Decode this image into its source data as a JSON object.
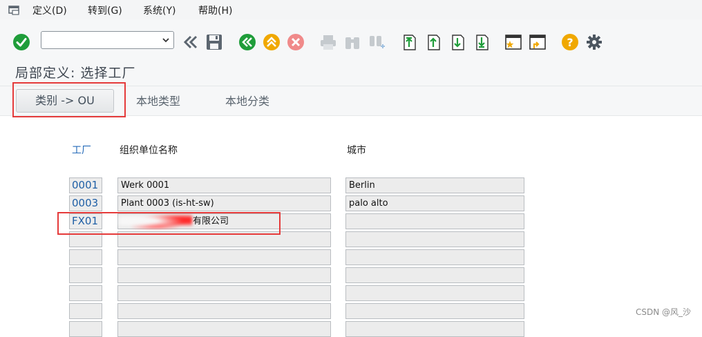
{
  "menu": {
    "items": [
      "定义(D)",
      "转到(G)",
      "系统(Y)",
      "帮助(H)"
    ]
  },
  "toolbar": {
    "command_field_value": "",
    "icons": [
      "enter-icon",
      "back-nav-icon",
      "save-icon",
      "back-icon",
      "exit-icon",
      "cancel-icon",
      "print-icon",
      "find-icon",
      "find-next-icon",
      "first-page-icon",
      "prev-page-icon",
      "next-page-icon",
      "last-page-icon",
      "new-session-icon",
      "shortcut-icon",
      "help-icon",
      "settings-icon"
    ]
  },
  "title": "局部定义: 选择工厂",
  "app_toolbar": {
    "primary_button": "类别  -> OU",
    "button_2": "本地类型",
    "button_3": "本地分类"
  },
  "table": {
    "headers": [
      "工厂",
      "组织单位名称",
      "城市"
    ],
    "rows": [
      {
        "plant": "0001",
        "org_name": "Werk 0001",
        "city": "Berlin"
      },
      {
        "plant": "0003",
        "org_name": "Plant 0003 (is-ht-sw)",
        "city": "palo alto"
      },
      {
        "plant": "FX01",
        "org_name": "有限公司",
        "city": ""
      },
      {
        "plant": "",
        "org_name": "",
        "city": ""
      },
      {
        "plant": "",
        "org_name": "",
        "city": ""
      },
      {
        "plant": "",
        "org_name": "",
        "city": ""
      },
      {
        "plant": "",
        "org_name": "",
        "city": ""
      },
      {
        "plant": "",
        "org_name": "",
        "city": ""
      },
      {
        "plant": "",
        "org_name": "",
        "city": ""
      }
    ]
  },
  "watermark": "CSDN @风_沙",
  "colors": {
    "accent_green": "#1f9d3a",
    "accent_orange": "#f0a800",
    "accent_red": "#e23b3b",
    "link_blue": "#2369b8",
    "highlight_box": "#e53a3a"
  }
}
